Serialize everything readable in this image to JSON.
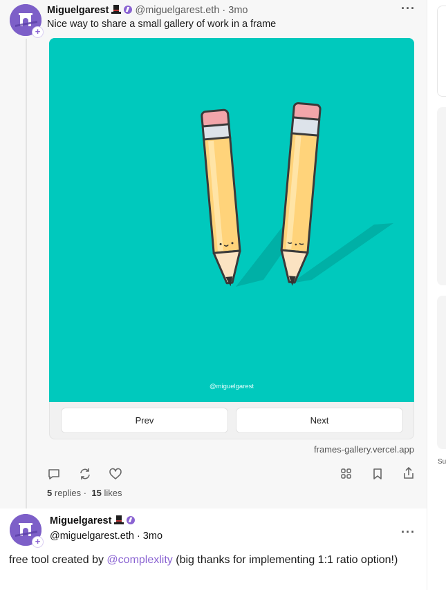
{
  "cast1": {
    "author": "Miguelgarest",
    "handle": "@miguelgarest.eth · 3mo",
    "text": "Nice way to share a small gallery of work in a frame",
    "frame": {
      "watermark": "@miguelgarest",
      "prev_label": "Prev",
      "next_label": "Next",
      "url": "frames-gallery.vercel.app"
    },
    "icons": [
      "reply-icon",
      "recast-icon",
      "like-icon",
      "grid-icon",
      "bookmark-icon",
      "share-icon"
    ],
    "replies_count": "5",
    "replies_label": "replies ·",
    "likes_count": "15",
    "likes_label": "likes"
  },
  "cast2": {
    "author": "Miguelgarest",
    "handle": "@miguelgarest.eth · 3mo",
    "text_before": "free tool created by ",
    "mention": "@complexlity",
    "text_after": " (big thanks for implementing 1:1 ratio option!)"
  },
  "sidebar": {
    "partial_text": "Su"
  },
  "colors": {
    "accent": "#8a63d2",
    "frame_bg": "#00c9bd"
  }
}
